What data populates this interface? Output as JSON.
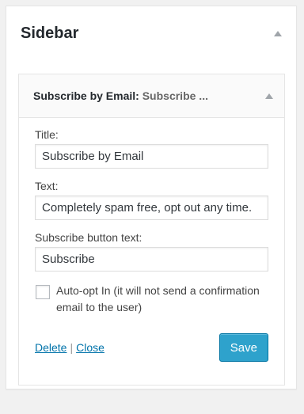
{
  "sidebar": {
    "title": "Sidebar"
  },
  "widget": {
    "header_title": "Subscribe by Email:",
    "header_subtitle": "Subscribe ...",
    "fields": {
      "title_label": "Title:",
      "title_value": "Subscribe by Email",
      "text_label": "Text:",
      "text_value": "Completely spam free, opt out any time.",
      "button_text_label": "Subscribe button text:",
      "button_text_value": "Subscribe"
    },
    "checkbox_label": "Auto-opt In (it will not send a confirmation email to the user)",
    "checkbox_checked": false,
    "links": {
      "delete": "Delete",
      "separator": "|",
      "close": "Close"
    },
    "save_label": "Save"
  },
  "colors": {
    "link": "#0073aa",
    "save_button": "#2ea2cc"
  }
}
